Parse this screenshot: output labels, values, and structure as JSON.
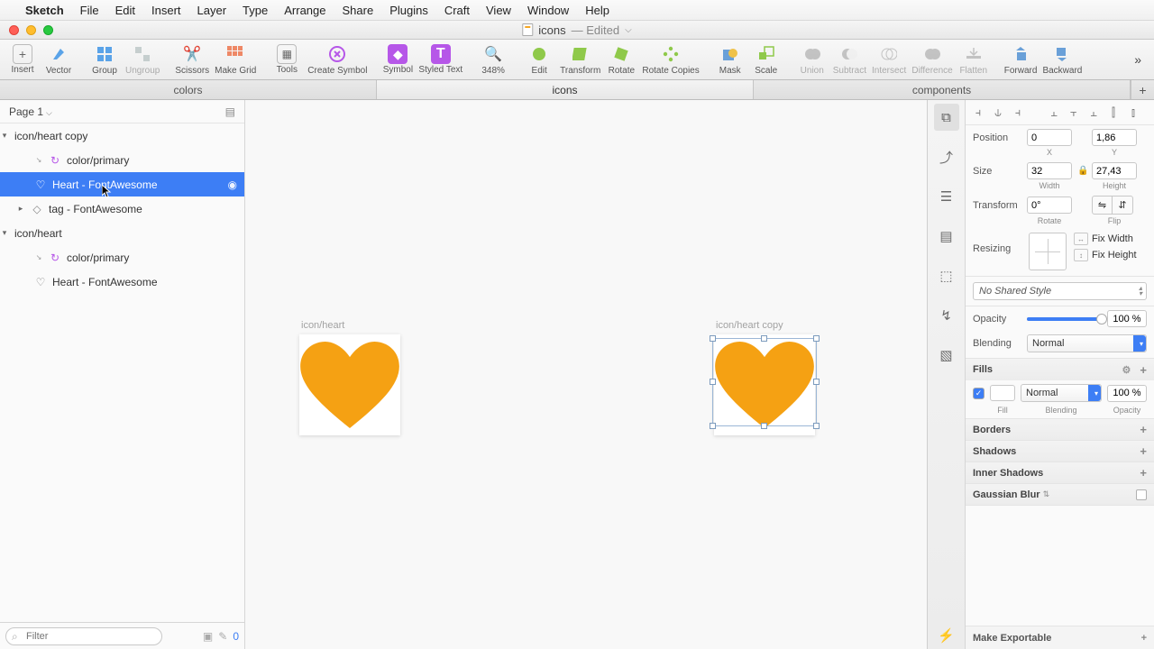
{
  "menubar": {
    "app": "Sketch",
    "items": [
      "File",
      "Edit",
      "Insert",
      "Layer",
      "Type",
      "Arrange",
      "Share",
      "Plugins",
      "Craft",
      "View",
      "Window",
      "Help"
    ]
  },
  "window": {
    "doc": "icons",
    "edited": "— Edited"
  },
  "toolbar": {
    "items": [
      {
        "label": "Insert",
        "icon": "+"
      },
      {
        "label": "Vector",
        "icon": "pen"
      },
      {
        "label": "Group",
        "icon": "group"
      },
      {
        "label": "Ungroup",
        "icon": "ungroup"
      },
      {
        "label": "Scissors",
        "icon": "scissors"
      },
      {
        "label": "Make Grid",
        "icon": "grid"
      },
      {
        "label": "Tools",
        "icon": "tools"
      },
      {
        "label": "Create Symbol",
        "icon": "symbol"
      },
      {
        "label": "Symbol",
        "icon": "symbol2"
      },
      {
        "label": "Styled Text",
        "icon": "T"
      },
      {
        "label": "348%",
        "icon": "zoom",
        "zoom": true
      },
      {
        "label": "Edit",
        "icon": "edit"
      },
      {
        "label": "Transform",
        "icon": "transform"
      },
      {
        "label": "Rotate",
        "icon": "rotate"
      },
      {
        "label": "Rotate Copies",
        "icon": "rcopies"
      },
      {
        "label": "Mask",
        "icon": "mask"
      },
      {
        "label": "Scale",
        "icon": "scale"
      },
      {
        "label": "Union",
        "icon": "union"
      },
      {
        "label": "Subtract",
        "icon": "subtract"
      },
      {
        "label": "Intersect",
        "icon": "intersect"
      },
      {
        "label": "Difference",
        "icon": "difference"
      },
      {
        "label": "Flatten",
        "icon": "flatten"
      },
      {
        "label": "Forward",
        "icon": "forward"
      },
      {
        "label": "Backward",
        "icon": "backward"
      }
    ]
  },
  "tabs": [
    "colors",
    "icons",
    "components"
  ],
  "page_selector": "Page 1",
  "layers": [
    {
      "type": "artboard",
      "name": "icon/heart copy",
      "depth": 0,
      "tri": "▾"
    },
    {
      "type": "symbol",
      "name": "color/primary",
      "depth": 1,
      "icon": "↻"
    },
    {
      "type": "shape",
      "name": "Heart - FontAwesome",
      "depth": 1,
      "icon": "♡",
      "selected": true,
      "eye": true
    },
    {
      "type": "shape",
      "name": "tag - FontAwesome",
      "depth": 1,
      "icon": "◇",
      "tri": "▸"
    },
    {
      "type": "artboard",
      "name": "icon/heart",
      "depth": 0,
      "tri": "▾"
    },
    {
      "type": "symbol",
      "name": "color/primary",
      "depth": 1,
      "icon": "↻"
    },
    {
      "type": "shape",
      "name": "Heart - FontAwesome",
      "depth": 1,
      "icon": "♡"
    }
  ],
  "filter_placeholder": "Filter",
  "filter_count": "0",
  "canvas": {
    "artboard1": {
      "label": "icon/heart"
    },
    "artboard2": {
      "label": "icon/heart copy"
    }
  },
  "inspector": {
    "position": {
      "label": "Position",
      "x": "0",
      "y": "1,86",
      "xl": "X",
      "yl": "Y"
    },
    "size": {
      "label": "Size",
      "w": "32",
      "h": "27,43",
      "wl": "Width",
      "hl": "Height"
    },
    "transform": {
      "label": "Transform",
      "rotate": "0°",
      "rl": "Rotate",
      "fl": "Flip"
    },
    "resizing": {
      "label": "Resizing",
      "fixw": "Fix Width",
      "fixh": "Fix Height"
    },
    "shared_style": "No Shared Style",
    "opacity": {
      "label": "Opacity",
      "value": "100 %"
    },
    "blending": {
      "label": "Blending",
      "value": "Normal"
    },
    "fills": {
      "label": "Fills",
      "blend": "Normal",
      "opacity": "100 %",
      "sub_fill": "Fill",
      "sub_blend": "Blending",
      "sub_op": "Opacity"
    },
    "borders": "Borders",
    "shadows": "Shadows",
    "inner_shadows": "Inner Shadows",
    "gaussian": "Gaussian Blur",
    "export": "Make Exportable"
  }
}
